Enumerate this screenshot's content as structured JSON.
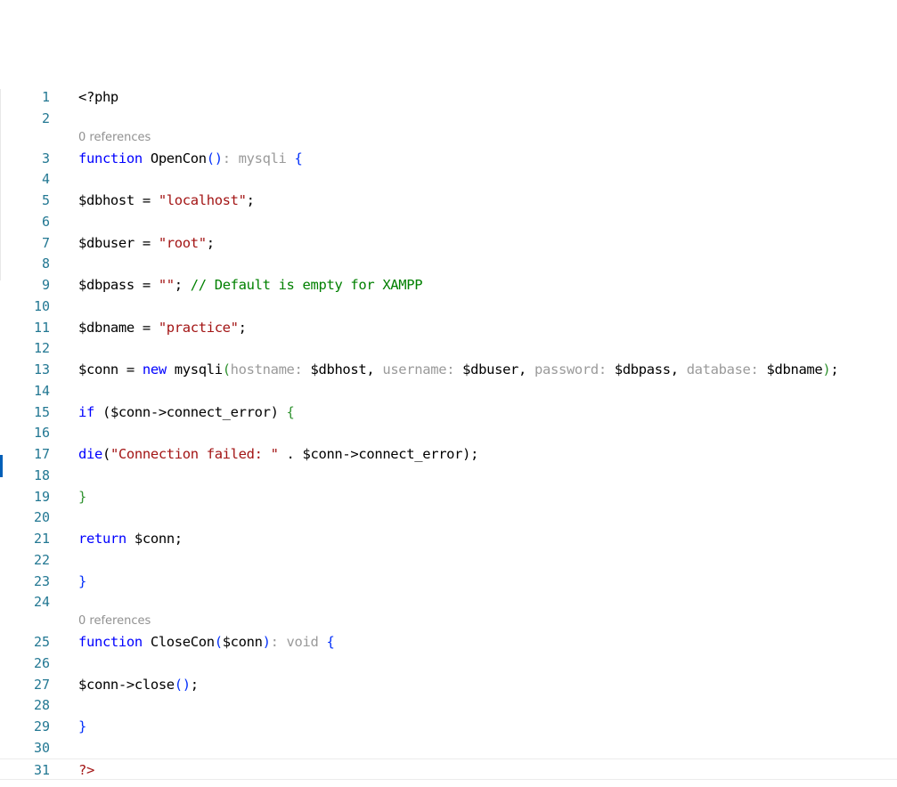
{
  "editor": {
    "lines": [
      {
        "n": "1",
        "tokens": [
          {
            "t": "<?php",
            "c": "plain"
          }
        ]
      },
      {
        "n": "2",
        "tokens": []
      },
      {
        "n": "3",
        "codelens": "0 references",
        "tokens": [
          {
            "t": "function",
            "c": "kw"
          },
          {
            "t": " OpenCon",
            "c": "plain"
          },
          {
            "t": "()",
            "c": "p1"
          },
          {
            "t": ": mysqli",
            "c": "hint"
          },
          {
            "t": " {",
            "c": "p1"
          }
        ]
      },
      {
        "n": "4",
        "tokens": []
      },
      {
        "n": "5",
        "tokens": [
          {
            "t": "$dbhost = ",
            "c": "plain"
          },
          {
            "t": "\"localhost\"",
            "c": "str"
          },
          {
            "t": ";",
            "c": "plain"
          }
        ]
      },
      {
        "n": "6",
        "tokens": []
      },
      {
        "n": "7",
        "tokens": [
          {
            "t": "$dbuser = ",
            "c": "plain"
          },
          {
            "t": "\"root\"",
            "c": "str"
          },
          {
            "t": ";",
            "c": "plain"
          }
        ]
      },
      {
        "n": "8",
        "tokens": []
      },
      {
        "n": "9",
        "tokens": [
          {
            "t": "$dbpass = ",
            "c": "plain"
          },
          {
            "t": "\"\"",
            "c": "str"
          },
          {
            "t": "; ",
            "c": "plain"
          },
          {
            "t": "// Default is empty for XAMPP",
            "c": "cmt"
          }
        ]
      },
      {
        "n": "10",
        "tokens": []
      },
      {
        "n": "11",
        "tokens": [
          {
            "t": "$dbname = ",
            "c": "plain"
          },
          {
            "t": "\"practice\"",
            "c": "str"
          },
          {
            "t": ";",
            "c": "plain"
          }
        ]
      },
      {
        "n": "12",
        "tokens": []
      },
      {
        "n": "13",
        "tokens": [
          {
            "t": "$conn = ",
            "c": "plain"
          },
          {
            "t": "new",
            "c": "kw"
          },
          {
            "t": " mysqli",
            "c": "plain"
          },
          {
            "t": "(",
            "c": "p2"
          },
          {
            "t": "hostname:",
            "c": "hint"
          },
          {
            "t": " $dbhost, ",
            "c": "plain"
          },
          {
            "t": "username:",
            "c": "hint"
          },
          {
            "t": " $dbuser, ",
            "c": "plain"
          },
          {
            "t": "password:",
            "c": "hint"
          },
          {
            "t": " $dbpass, ",
            "c": "plain"
          },
          {
            "t": "database:",
            "c": "hint"
          },
          {
            "t": " $dbname",
            "c": "plain"
          },
          {
            "t": ")",
            "c": "p2"
          },
          {
            "t": ";",
            "c": "plain"
          }
        ]
      },
      {
        "n": "14",
        "tokens": []
      },
      {
        "n": "15",
        "tokens": [
          {
            "t": "if",
            "c": "kw"
          },
          {
            "t": " (",
            "c": "plain"
          },
          {
            "t": "$conn->connect_error",
            "c": "plain"
          },
          {
            "t": ")",
            "c": "plain"
          },
          {
            "t": " {",
            "c": "p2"
          }
        ]
      },
      {
        "n": "16",
        "tokens": []
      },
      {
        "n": "17",
        "tokens": [
          {
            "t": "die",
            "c": "kw"
          },
          {
            "t": "(",
            "c": "plain"
          },
          {
            "t": "\"Connection failed: \"",
            "c": "str"
          },
          {
            "t": " . $conn->connect_error);",
            "c": "plain"
          }
        ]
      },
      {
        "n": "18",
        "tokens": []
      },
      {
        "n": "19",
        "tokens": [
          {
            "t": "}",
            "c": "p2"
          }
        ]
      },
      {
        "n": "20",
        "tokens": []
      },
      {
        "n": "21",
        "tokens": [
          {
            "t": "return",
            "c": "kw"
          },
          {
            "t": " $conn;",
            "c": "plain"
          }
        ]
      },
      {
        "n": "22",
        "tokens": []
      },
      {
        "n": "23",
        "tokens": [
          {
            "t": "}",
            "c": "p1"
          }
        ]
      },
      {
        "n": "24",
        "tokens": []
      },
      {
        "n": "25",
        "codelens": "0 references",
        "tokens": [
          {
            "t": "function",
            "c": "kw"
          },
          {
            "t": " CloseCon",
            "c": "plain"
          },
          {
            "t": "(",
            "c": "p1"
          },
          {
            "t": "$conn",
            "c": "plain"
          },
          {
            "t": ")",
            "c": "p1"
          },
          {
            "t": ": void",
            "c": "hint"
          },
          {
            "t": " {",
            "c": "p1"
          }
        ]
      },
      {
        "n": "26",
        "tokens": []
      },
      {
        "n": "27",
        "tokens": [
          {
            "t": "$conn->close",
            "c": "plain"
          },
          {
            "t": "()",
            "c": "p1"
          },
          {
            "t": ";",
            "c": "plain"
          }
        ]
      },
      {
        "n": "28",
        "tokens": []
      },
      {
        "n": "29",
        "tokens": [
          {
            "t": "}",
            "c": "p1"
          }
        ]
      },
      {
        "n": "30",
        "tokens": []
      },
      {
        "n": "31",
        "tokens": [
          {
            "t": "?>",
            "c": "str"
          }
        ]
      }
    ]
  },
  "colors": {
    "keyword": "#0000ff",
    "string": "#a31515",
    "comment": "#008000",
    "inlay_hint": "#9a9a9a",
    "line_number": "#237893",
    "bracket_level_1": "#0431fa",
    "bracket_level_2": "#319331"
  }
}
